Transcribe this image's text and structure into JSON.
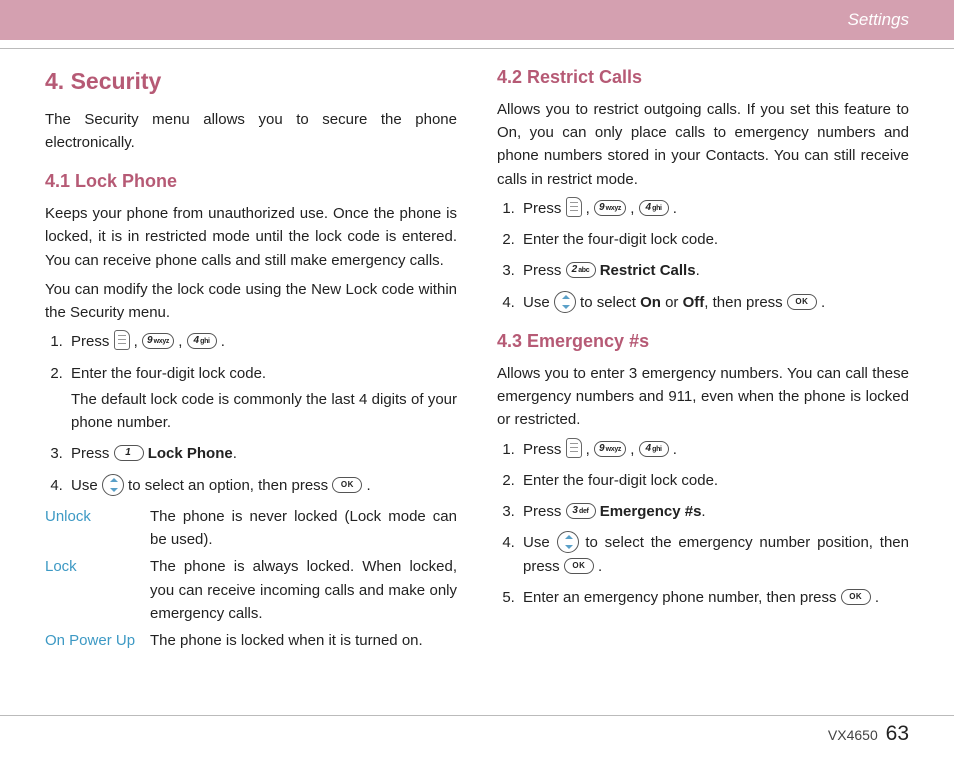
{
  "header": {
    "title": "Settings"
  },
  "left": {
    "sec_title": "4. Security",
    "sec_intro": "The Security menu allows you to secure the phone electronically.",
    "s41_title": "4.1 Lock Phone",
    "s41_p1": "Keeps your phone from unauthorized use. Once the phone is locked, it is in restricted mode until the lock code is entered. You can receive phone calls and still make emergency calls.",
    "s41_p2": "You can modify the lock code using the New Lock code within the Security menu.",
    "s41_steps": {
      "s1_press": "Press",
      "s2": "Enter the four-digit lock code.",
      "s2b": "The default lock code is commonly the last 4 digits of your phone number.",
      "s3_press": "Press",
      "s3_bold": "Lock Phone",
      "s4_use": "Use",
      "s4_mid": "to select an option, then press"
    },
    "opts": {
      "unlock": "Unlock",
      "unlock_def": "The phone is never locked (Lock mode can be used).",
      "lock": "Lock",
      "lock_def": "The phone is always locked. When locked, you can receive incoming calls and make only emergency calls.",
      "onpower": "On Power Up",
      "onpower_def": "The phone is locked when it is turned on."
    }
  },
  "right": {
    "s42_title": "4.2 Restrict Calls",
    "s42_p": "Allows you to restrict outgoing calls. If you set this feature to On, you can only place calls to emergency numbers and phone numbers stored in your Contacts. You can still receive calls in restrict mode.",
    "s42_steps": {
      "s1_press": "Press",
      "s2": "Enter the four-digit lock code.",
      "s3_press": "Press",
      "s3_bold": "Restrict Calls",
      "s4_use": "Use",
      "s4_mid": "to select",
      "s4_on": "On",
      "s4_or": "or",
      "s4_off": "Off",
      "s4_then": ", then press"
    },
    "s43_title": "4.3 Emergency #s",
    "s43_p": "Allows you to enter 3 emergency numbers. You can call these emergency numbers and 911, even when the phone is locked or restricted.",
    "s43_steps": {
      "s1_press": "Press",
      "s2": "Enter the four-digit lock code.",
      "s3_press": "Press",
      "s3_bold": "Emergency #s",
      "s4_use": "Use",
      "s4_mid": "to select the emergency number position, then press",
      "s5": "Enter an emergency phone number, then press"
    }
  },
  "keys": {
    "k9n": "9",
    "k9t": "wxyz",
    "k4n": "4",
    "k4t": "ghi",
    "k1n": "1",
    "k1t": "",
    "k2n": "2",
    "k2t": "abc",
    "k3n": "3",
    "k3t": "def",
    "ok": "OK"
  },
  "footer": {
    "model": "VX4650",
    "page": "63"
  }
}
